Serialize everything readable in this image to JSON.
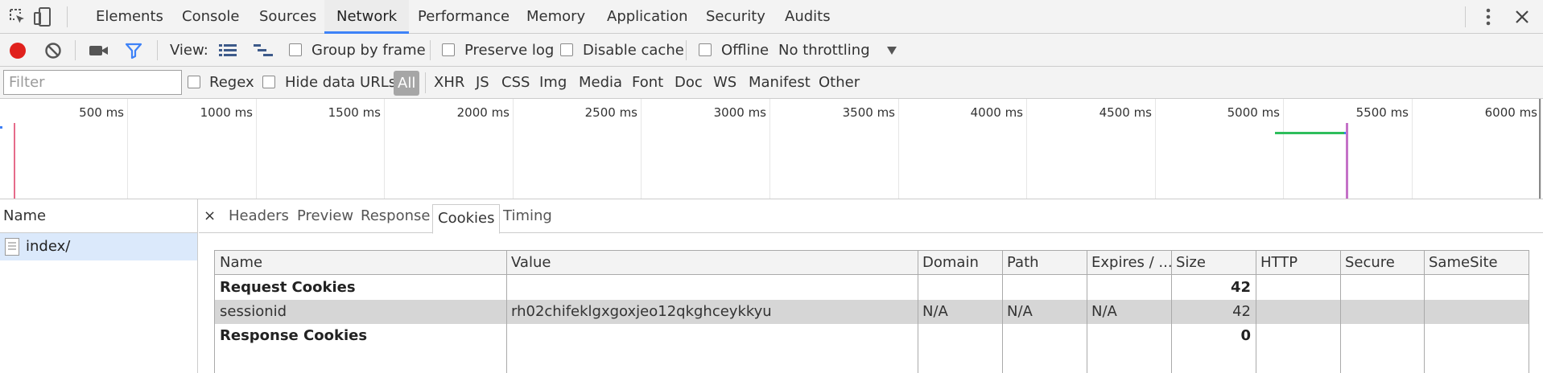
{
  "main_tabs": [
    "Elements",
    "Console",
    "Sources",
    "Network",
    "Performance",
    "Memory",
    "Application",
    "Security",
    "Audits"
  ],
  "active_tab": "Network",
  "toolbar": {
    "view_label": "View:",
    "group_by_frame": "Group by frame",
    "preserve_log": "Preserve log",
    "disable_cache": "Disable cache",
    "offline": "Offline",
    "throttling": "No throttling"
  },
  "filter_bar": {
    "filter_placeholder": "Filter",
    "regex": "Regex",
    "hide_data_urls": "Hide data URLs",
    "types": [
      "All",
      "XHR",
      "JS",
      "CSS",
      "Img",
      "Media",
      "Font",
      "Doc",
      "WS",
      "Manifest",
      "Other"
    ],
    "active_type": "All"
  },
  "timeline": {
    "ticks": [
      "500 ms",
      "1000 ms",
      "1500 ms",
      "2000 ms",
      "2500 ms",
      "3000 ms",
      "3500 ms",
      "4000 ms",
      "4500 ms",
      "5000 ms",
      "5500 ms",
      "6000 ms"
    ],
    "colors": {
      "dom_content_loaded": "#3d7ff5",
      "load": "#e66b8a",
      "waiting": "#2ebe5c",
      "finish": "#c471c7"
    }
  },
  "requests": {
    "header": "Name",
    "items": [
      "index/"
    ]
  },
  "detail": {
    "close": "×",
    "tabs": [
      "Headers",
      "Preview",
      "Response",
      "Cookies",
      "Timing"
    ],
    "active_tab": "Cookies"
  },
  "cookies": {
    "columns": [
      "Name",
      "Value",
      "Domain",
      "Path",
      "Expires / ...",
      "Size",
      "HTTP",
      "Secure",
      "SameSite"
    ],
    "request_section": {
      "label": "Request Cookies",
      "size": "42"
    },
    "rows": [
      {
        "name": "sessionid",
        "value": "rh02chifeklgxgoxjeo12qkghceykkyu",
        "domain": "N/A",
        "path": "N/A",
        "expires": "N/A",
        "size": "42",
        "http": "",
        "secure": "",
        "samesite": ""
      }
    ],
    "response_section": {
      "label": "Response Cookies",
      "size": "0"
    }
  },
  "colors": {
    "record": "#e0211d",
    "accent": "#3e82f7"
  }
}
